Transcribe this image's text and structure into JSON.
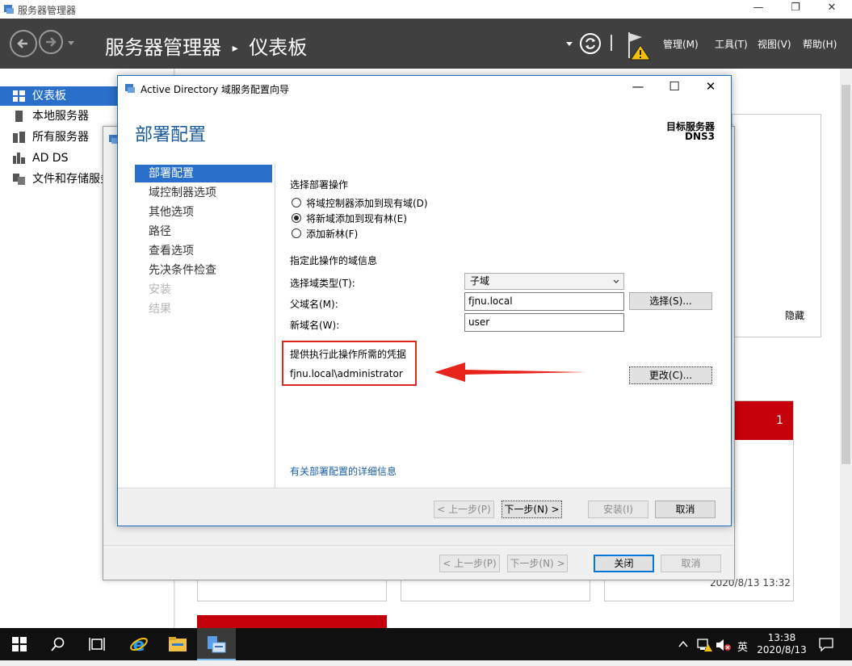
{
  "window": {
    "title": "服务器管理器",
    "controls": {
      "minimize": "—",
      "maximize": "❐",
      "close": "✕"
    }
  },
  "header": {
    "breadcrumb_app": "服务器管理器",
    "breadcrumb_sep": "▸",
    "breadcrumb_page": "仪表板",
    "menus": [
      "管理(M)",
      "工具(T)",
      "视图(V)",
      "帮助(H)"
    ]
  },
  "sidebar": {
    "items": [
      {
        "label": "仪表板",
        "icon": "dashboard-icon",
        "active": true
      },
      {
        "label": "本地服务器",
        "icon": "server-icon",
        "active": false
      },
      {
        "label": "所有服务器",
        "icon": "servers-icon",
        "active": false
      },
      {
        "label": "AD DS",
        "icon": "adds-icon",
        "active": false
      },
      {
        "label": "文件和存储服务",
        "icon": "storage-icon",
        "active": false
      }
    ]
  },
  "main": {
    "hide_label": "隐藏",
    "tile_count": "1",
    "timestamp": "2020/8/13 13:32"
  },
  "back_dialog": {
    "buttons": {
      "prev": "< 上一步(P)",
      "next": "下一步(N) >",
      "close": "关闭",
      "cancel": "取消"
    }
  },
  "dialog": {
    "title": "Active Directory 域服务配置向导",
    "heading": "部署配置",
    "target_label": "目标服务器",
    "target_value": "DNS3",
    "steps": [
      {
        "label": "部署配置",
        "state": "active"
      },
      {
        "label": "域控制器选项",
        "state": "normal"
      },
      {
        "label": "其他选项",
        "state": "normal"
      },
      {
        "label": "路径",
        "state": "normal"
      },
      {
        "label": "查看选项",
        "state": "normal"
      },
      {
        "label": "先决条件检查",
        "state": "normal"
      },
      {
        "label": "安装",
        "state": "disabled"
      },
      {
        "label": "结果",
        "state": "disabled"
      }
    ],
    "operation_title": "选择部署操作",
    "operations": [
      {
        "label": "将域控制器添加到现有域(D)",
        "selected": false
      },
      {
        "label": "将新域添加到现有林(E)",
        "selected": true
      },
      {
        "label": "添加新林(F)",
        "selected": false
      }
    ],
    "domain_info_title": "指定此操作的域信息",
    "domain_type_label": "选择域类型(T):",
    "domain_type_value": "子域",
    "parent_label": "父域名(M):",
    "parent_value": "fjnu.local",
    "select_button": "选择(S)...",
    "new_domain_label": "新域名(W):",
    "new_domain_value": "user",
    "cred_title": "提供执行此操作所需的凭据",
    "cred_value": "fjnu.local\\administrator",
    "change_button": "更改(C)...",
    "more_link": "有关部署配置的详细信息",
    "buttons": {
      "prev": "< 上一步(P)",
      "next": "下一步(N) >",
      "install": "安装(I)",
      "cancel": "取消"
    }
  },
  "taskbar": {
    "ime": "英",
    "time": "13:38",
    "date": "2020/8/13"
  },
  "colors": {
    "accent": "#2a6fc9",
    "header_bg": "#404040",
    "alert_red": "#c4000a",
    "annotation_red": "#e0281e"
  }
}
